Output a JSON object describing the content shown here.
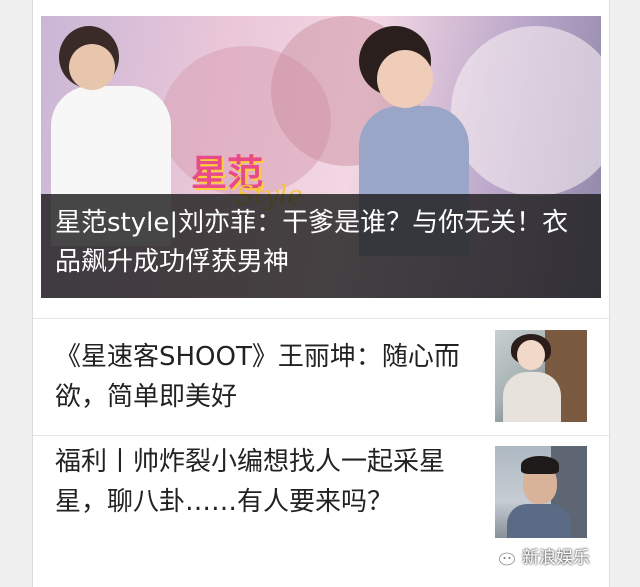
{
  "hero": {
    "logo_main": "星范",
    "logo_sub": "Style",
    "caption": "星范style|刘亦菲：干爹是谁？与你无关！衣品飙升成功俘获男神"
  },
  "articles": [
    {
      "title": "《星速客SHOOT》王丽坤：随心而欲，简单即美好"
    },
    {
      "title": "福利丨帅炸裂小编想找人一起采星星，聊八卦……有人要来吗？"
    }
  ],
  "watermark": {
    "icon": "wechat-icon",
    "text": "新浪娱乐"
  }
}
